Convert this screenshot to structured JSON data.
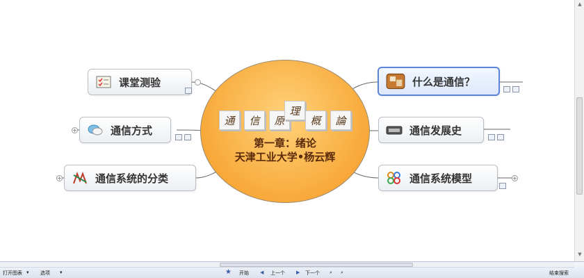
{
  "central": {
    "title_chars": [
      "通",
      "信",
      "原",
      "理",
      "概",
      "論"
    ],
    "line1": "第一章：绪论",
    "line2": "天津工业大学•杨云辉"
  },
  "topics": {
    "quiz": "课堂测验",
    "comm_mode": "通信方式",
    "classification": "通信系统的分类",
    "what_is": "什么是通信？",
    "history": "通信发展史",
    "model": "通信系统模型"
  },
  "statusbar": {
    "open_chart": "打开图表",
    "options": "选项",
    "start": "开始",
    "prev": "上一个",
    "next": "下一个",
    "end": "结束搜索"
  },
  "colors": {
    "central_fill": "#f8a93a",
    "selected_border": "#5b84d8",
    "topic_border": "#b9bdc4"
  }
}
